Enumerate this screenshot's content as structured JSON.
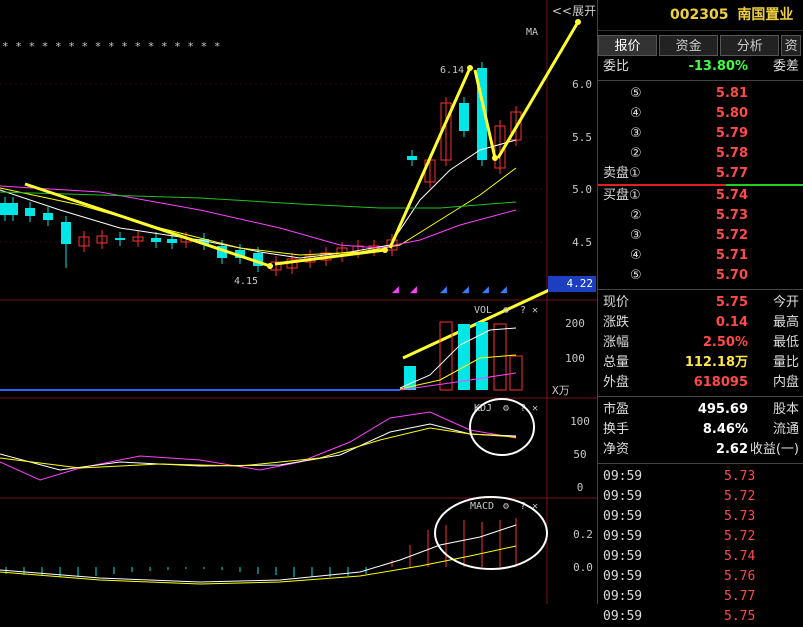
{
  "stock": {
    "code": "002305",
    "name": "南国置业"
  },
  "toolbar": {
    "expand_label": "<<展开"
  },
  "tabs": [
    {
      "label": "报价"
    },
    {
      "label": "资金"
    },
    {
      "label": "分析"
    },
    {
      "label": "资"
    }
  ],
  "quote": {
    "weibi": {
      "label": "委比",
      "value": "-13.80%",
      "label2": "委差"
    },
    "sell": [
      {
        "level": "⑤",
        "price": "5.81"
      },
      {
        "level": "④",
        "price": "5.80"
      },
      {
        "level": "③",
        "price": "5.79"
      },
      {
        "level": "②",
        "price": "5.78"
      },
      {
        "level": "卖盘①",
        "price": "5.77"
      }
    ],
    "buy": [
      {
        "level": "买盘①",
        "price": "5.74"
      },
      {
        "level": "②",
        "price": "5.73"
      },
      {
        "level": "③",
        "price": "5.72"
      },
      {
        "level": "④",
        "price": "5.71"
      },
      {
        "level": "⑤",
        "price": "5.70"
      }
    ],
    "stats": [
      {
        "label": "现价",
        "value": "5.75",
        "label2": "今开",
        "color": "red"
      },
      {
        "label": "涨跌",
        "value": "0.14",
        "label2": "最高",
        "color": "red"
      },
      {
        "label": "涨幅",
        "value": "2.50%",
        "label2": "最低",
        "color": "red"
      },
      {
        "label": "总量",
        "value": "112.18万",
        "label2": "量比",
        "color": "yel"
      },
      {
        "label": "外盘",
        "value": "618095",
        "label2": "内盘",
        "color": "red"
      }
    ],
    "stats2": [
      {
        "label": "市盈",
        "value": "495.69",
        "label2": "股本",
        "color": "wht"
      },
      {
        "label": "换手",
        "value": "8.46%",
        "label2": "流通",
        "color": "wht"
      },
      {
        "label": "净资",
        "value": "2.62",
        "label2": "收益(一)",
        "color": "wht"
      }
    ]
  },
  "trades": [
    {
      "time": "09:59",
      "price": "5.73"
    },
    {
      "time": "09:59",
      "price": "5.72"
    },
    {
      "time": "09:59",
      "price": "5.73"
    },
    {
      "time": "09:59",
      "price": "5.72"
    },
    {
      "time": "09:59",
      "price": "5.74"
    },
    {
      "time": "09:59",
      "price": "5.76"
    },
    {
      "time": "09:59",
      "price": "5.77"
    },
    {
      "time": "09:59",
      "price": "5.75"
    }
  ],
  "chart": {
    "stars": "* *      * *    * * * *    * * * * *      * *    * *",
    "ma_label": "MA",
    "price_ticks": [
      "6.0",
      "5.5",
      "5.0",
      "4.5"
    ],
    "current_price": "4.22",
    "high_annot": "6.14",
    "low_annot": "4.15",
    "vol_label": "VOL",
    "vol_ticks": [
      "200",
      "100"
    ],
    "vol_unit": "X万",
    "kdj_label": "KDJ",
    "kdj_ticks": [
      "100",
      "50",
      "0"
    ],
    "macd_label": "MACD",
    "macd_ticks": [
      "0.2",
      "0.0"
    ],
    "help": "?",
    "close": "✕"
  },
  "colors": {
    "up": "#ff3030",
    "down": "#00e5e5",
    "annot": "#ffff30",
    "ma5": "#ffffff",
    "ma10": "#ffff00",
    "ma20": "#ff40ff",
    "ma60": "#20c020"
  }
}
